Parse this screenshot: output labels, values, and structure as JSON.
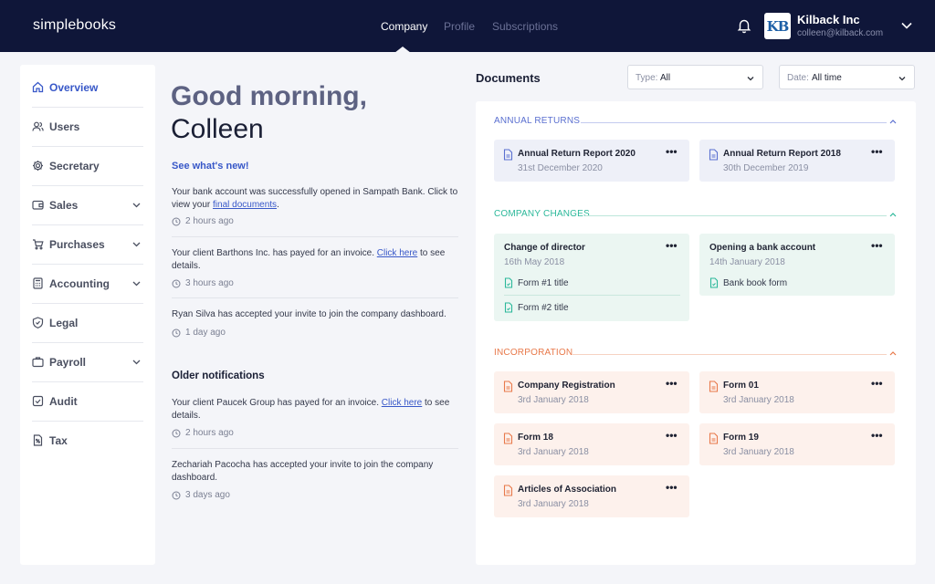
{
  "app": {
    "brand": "simplebooks",
    "nav": [
      "Company",
      "Profile",
      "Subscriptions"
    ],
    "account": {
      "logo_text": "KB",
      "company": "Kilback Inc",
      "email": "colleen@kilback.com"
    }
  },
  "sidebar": {
    "items": [
      {
        "label": "Overview",
        "icon": "home-icon",
        "active": true
      },
      {
        "label": "Users",
        "icon": "users-icon"
      },
      {
        "label": "Secretary",
        "icon": "gear-icon"
      },
      {
        "label": "Sales",
        "icon": "wallet-icon",
        "has_submenu": true
      },
      {
        "label": "Purchases",
        "icon": "cart-icon",
        "has_submenu": true
      },
      {
        "label": "Accounting",
        "icon": "calculator-icon",
        "has_submenu": true
      },
      {
        "label": "Legal",
        "icon": "shield-icon"
      },
      {
        "label": "Payroll",
        "icon": "briefcase-icon",
        "has_submenu": true
      },
      {
        "label": "Audit",
        "icon": "check-square-icon"
      },
      {
        "label": "Tax",
        "icon": "tax-document-icon"
      }
    ]
  },
  "feed": {
    "greeting_line1": "Good morning,",
    "greeting_line2": "Colleen",
    "whats_new": "See what's new!",
    "notifications": [
      {
        "pre": "Your bank account was successfully opened in Sampath Bank. Click to view your ",
        "link": "final documents",
        "post": ".",
        "time": "2 hours ago"
      },
      {
        "pre": "Your client Barthons Inc. has payed for an invoice. ",
        "link": "Click here",
        "post": " to see details.",
        "time": "3 hours ago"
      },
      {
        "pre": "Ryan Silva has accepted your invite to join the company dashboard.",
        "link": "",
        "post": "",
        "time": "1 day ago"
      }
    ],
    "older_title": "Older notifications",
    "older": [
      {
        "pre": "Your client Paucek Group has payed for an invoice. ",
        "link": "Click here",
        "post": " to see details.",
        "time": "2 hours ago"
      },
      {
        "pre": "Zechariah Pacocha has accepted your invite to join the company dashboard.",
        "link": "",
        "post": "",
        "time": "3 days ago"
      }
    ]
  },
  "documents": {
    "title": "Documents",
    "type_filter": {
      "prefix": "Type:",
      "value": "All"
    },
    "date_filter": {
      "prefix": "Date:",
      "value": "All time"
    },
    "menu_glyph": "•••",
    "sections": [
      {
        "label": "ANNUAL RETURNS",
        "color": "#5a6fd0",
        "cards": [
          {
            "title": "Annual Return Report 2020",
            "date": "31st December 2020"
          },
          {
            "title": "Annual Return Report 2018",
            "date": "30th December 2019"
          }
        ]
      },
      {
        "label": "COMPANY CHANGES",
        "color": "#2bb89a",
        "cards": [
          {
            "title": "Change of director",
            "date": "16th May 2018",
            "forms": [
              "Form #1 title",
              "Form #2 title"
            ]
          },
          {
            "title": "Opening a bank account",
            "date": "14th January 2018",
            "forms": [
              "Bank book form"
            ]
          }
        ]
      },
      {
        "label": "INCORPORATION",
        "color": "#e8794a",
        "cards": [
          {
            "title": "Company Registration",
            "date": "3rd January 2018"
          },
          {
            "title": "Form 01",
            "date": "3rd January 2018"
          },
          {
            "title": "Form 18",
            "date": "3rd January 2018"
          },
          {
            "title": "Form 19",
            "date": "3rd January 2018"
          },
          {
            "title": "Articles of Association",
            "date": "3rd January 2018"
          }
        ]
      }
    ]
  }
}
